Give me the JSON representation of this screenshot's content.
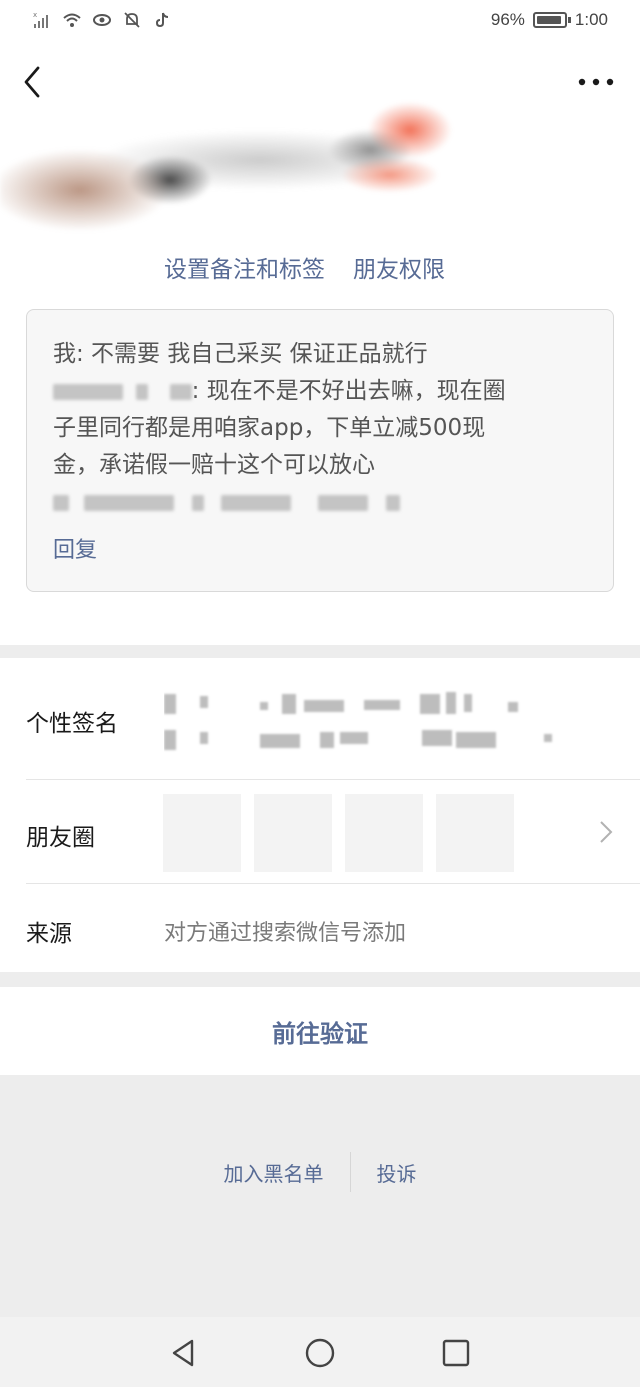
{
  "status_bar": {
    "battery": "96%",
    "time": "1:00",
    "icons": [
      "signal-icon",
      "wifi-icon",
      "eye-icon",
      "bell-off-icon",
      "tiktok-icon"
    ]
  },
  "nav": {
    "back_icon": "chevron-left-icon",
    "more_icon": "more-dots-icon"
  },
  "profile": {
    "set_remark_label": "设置备注和标签",
    "friend_permissions_label": "朋友权限"
  },
  "message": {
    "line1": "我: 不需要 我自己采买 保证正品就行",
    "line2_visible": ": 现在不是不好出去嘛，现在圈",
    "line3": "子里同行都是用咱家app，下单立减500现",
    "line4": "金，承诺假一赔十这个可以放心",
    "reply_label": "回复"
  },
  "info": {
    "signature_label": "个性签名",
    "moments_label": "朋友圈",
    "source_label": "来源",
    "source_value": "对方通过搜索微信号添加"
  },
  "actions": {
    "verify_label": "前往验证",
    "blacklist_label": "加入黑名单",
    "complain_label": "投诉"
  },
  "colors": {
    "link": "#576b95",
    "background": "#ededed",
    "card": "#f7f7f7"
  }
}
